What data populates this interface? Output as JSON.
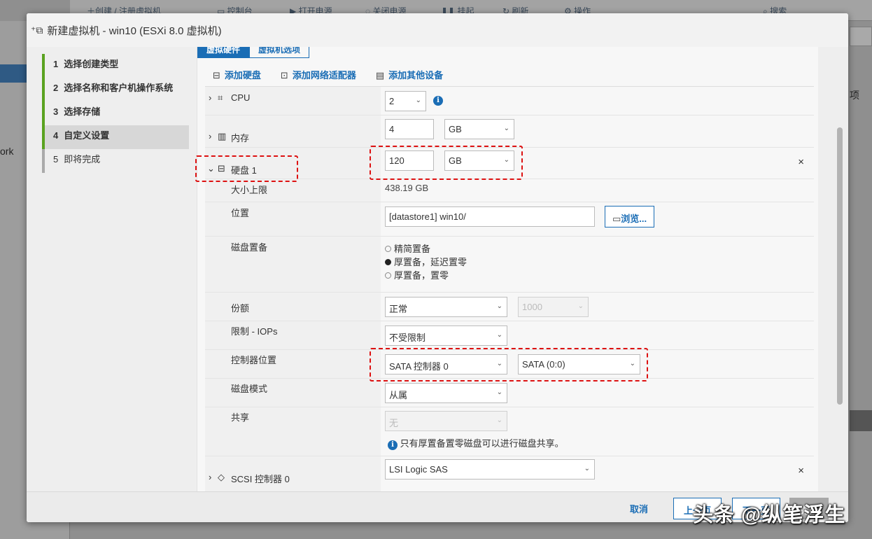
{
  "background": {
    "toolbar": {
      "create_label": "创建 / 注册虚拟机",
      "console_label": "控制台",
      "power_on_label": "打开电源",
      "power_off_label": "关闭电源",
      "suspend_label": "挂起",
      "refresh_label": "刷新",
      "actions_label": "操作",
      "search_label": "搜索"
    },
    "left_text": "ork",
    "right_text": "项"
  },
  "dialog": {
    "title": "新建虚拟机 - win10 (ESXi 8.0 虚拟机)",
    "steps": [
      {
        "num": "1",
        "label": "选择创建类型"
      },
      {
        "num": "2",
        "label": "选择名称和客户机操作系统"
      },
      {
        "num": "3",
        "label": "选择存储"
      },
      {
        "num": "4",
        "label": "自定义设置"
      },
      {
        "num": "5",
        "label": "即将完成"
      }
    ],
    "tabs": {
      "hardware": "虚拟硬件",
      "options": "虚拟机选项"
    },
    "add": {
      "disk": "添加硬盘",
      "network": "添加网络适配器",
      "other": "添加其他设备"
    },
    "cpu": {
      "label": "CPU",
      "value": "2"
    },
    "memory": {
      "label": "内存",
      "value": "4",
      "unit": "GB"
    },
    "disk": {
      "label": "硬盘 1",
      "size": "120",
      "unit": "GB",
      "max_label": "大小上限",
      "max_value": "438.19 GB",
      "location_label": "位置",
      "location_value": "[datastore1] win10/",
      "browse_label": "浏览...",
      "provision_label": "磁盘置备",
      "provision_options": [
        "精简置备",
        "厚置备，延迟置零",
        "厚置备，置零"
      ],
      "shares_label": "份额",
      "shares_value": "正常",
      "shares_number": "1000",
      "iops_label": "限制 - IOPs",
      "iops_value": "不受限制",
      "controller_label": "控制器位置",
      "controller_value": "SATA 控制器 0",
      "controller_slot": "SATA (0:0)",
      "mode_label": "磁盘模式",
      "mode_value": "从属",
      "sharing_label": "共享",
      "sharing_value": "无",
      "sharing_note": "只有厚置备置零磁盘可以进行磁盘共享。"
    },
    "scsi": {
      "label": "SCSI 控制器 0",
      "value": "LSI Logic SAS"
    },
    "footer": {
      "cancel": "取消",
      "back": "上一页",
      "next": "下一页",
      "finish": "完成"
    }
  },
  "watermark": "头条 @纵笔浮生"
}
